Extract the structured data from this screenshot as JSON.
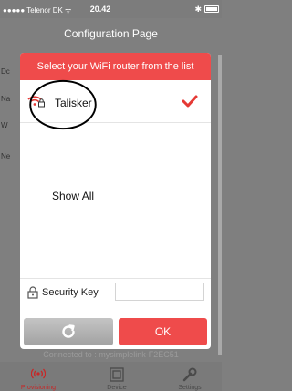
{
  "status_bar": {
    "carrier": "●●●●● Telenor DK ᯤ",
    "time": "20.42",
    "bluetooth": "✱"
  },
  "page": {
    "title": "Configuration Page",
    "left_letters": [
      "Dc",
      "Na",
      "W",
      "Ne"
    ],
    "connected_text": "Connected to : mysimplelink-F2EC51"
  },
  "tabs": [
    {
      "label": "Provisioning",
      "icon": "wifi-icon",
      "color": "#c62828"
    },
    {
      "label": "Device",
      "icon": "device-icon",
      "color": "#4a4a4a"
    },
    {
      "label": "Settings",
      "icon": "wrench-icon",
      "color": "#4a4a4a"
    }
  ],
  "dialog": {
    "header": "Select your WiFi router from the list",
    "networks": [
      {
        "name": "Talisker",
        "selected": true,
        "secured": true
      }
    ],
    "show_all_label": "Show All",
    "security_key_label": "Security Key",
    "security_key_value": "",
    "ok_label": "OK"
  },
  "colors": {
    "accent": "#ef4b4b",
    "check": "#e53935"
  }
}
